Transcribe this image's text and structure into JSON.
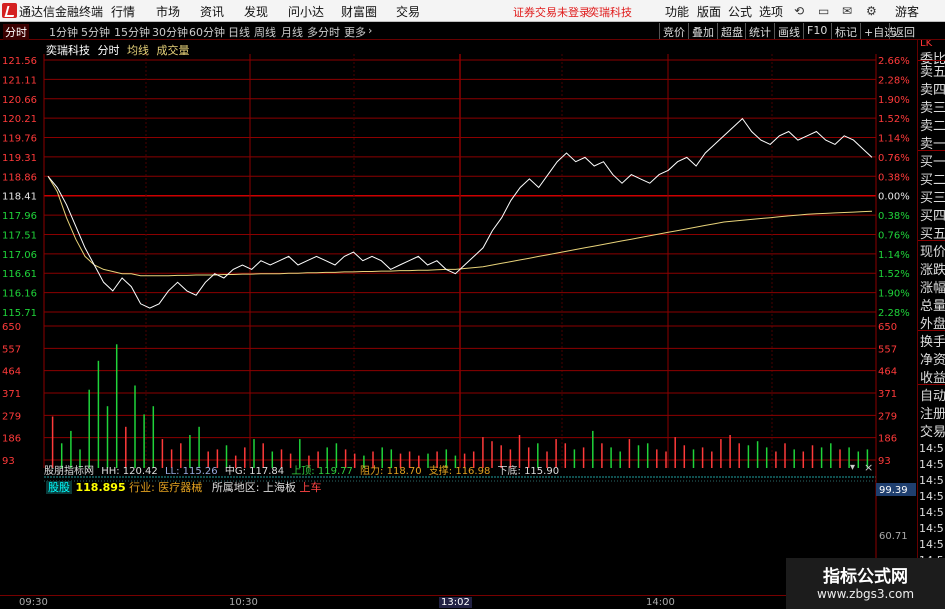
{
  "titlebar": {
    "app_title": "通达信金融终端",
    "menus": [
      "行情",
      "市场",
      "资讯",
      "发现",
      "问小达",
      "财富圈",
      "交易"
    ],
    "warning": "证券交易未登录",
    "stock_name": "奕瑞科技",
    "right_menus": [
      "功能",
      "版面",
      "公式",
      "选项"
    ],
    "guest": "游客"
  },
  "tabbar": {
    "tabs": [
      "分时",
      "1分钟",
      "5分钟",
      "15分钟",
      "30分钟",
      "60分钟",
      "日线",
      "周线",
      "月线",
      "多分时",
      "更多"
    ],
    "right_buttons": [
      "竞价",
      "叠加",
      "超盘",
      "统计",
      "画线",
      "F10",
      "标记",
      "+自选",
      "返回"
    ]
  },
  "chart_info": {
    "name": "奕瑞科技",
    "mode": "分时",
    "avg_label": "均线",
    "vol_label": "成交量"
  },
  "colors": {
    "price_line": "#ffffff",
    "avg_line": "#e8d37a",
    "grid": "#8b0000",
    "up": "#ff3a3a",
    "down": "#1fd43a",
    "neutral_axis": "#e6e6e6"
  },
  "chart_data": {
    "type": "line",
    "x_ticks": [
      "09:30",
      "10:30",
      "13:02",
      "14:00"
    ],
    "price_axis": [
      "121.56",
      "121.11",
      "120.66",
      "120.21",
      "119.76",
      "119.31",
      "118.86",
      "118.41",
      "117.96",
      "117.51",
      "117.06",
      "116.61",
      "116.16",
      "115.71"
    ],
    "pct_axis": [
      "2.66%",
      "2.28%",
      "1.90%",
      "1.52%",
      "1.14%",
      "0.76%",
      "0.38%",
      "0.00%",
      "0.38%",
      "0.76%",
      "1.14%",
      "1.52%",
      "1.90%",
      "2.28%"
    ],
    "prev_close": 118.41,
    "ylim": [
      115.71,
      121.56
    ],
    "volume_axis": [
      "650",
      "557",
      "464",
      "371",
      "279",
      "186",
      "93"
    ],
    "volume_max": 650,
    "series": [
      {
        "name": "价格",
        "values": [
          118.86,
          118.6,
          118.2,
          117.7,
          117.2,
          116.8,
          116.4,
          116.2,
          116.5,
          116.3,
          115.9,
          115.8,
          115.9,
          116.2,
          116.4,
          116.2,
          116.1,
          116.4,
          116.6,
          116.5,
          116.7,
          116.8,
          116.7,
          116.9,
          116.8,
          116.9,
          117.0,
          116.8,
          116.9,
          117.0,
          116.9,
          116.8,
          117.0,
          117.1,
          116.9,
          117.0,
          116.9,
          116.7,
          116.8,
          116.9,
          117.0,
          116.8,
          116.9,
          116.7,
          116.6,
          116.8,
          117.0,
          117.2,
          117.6,
          117.9,
          118.3,
          118.6,
          118.8,
          118.6,
          118.9,
          119.2,
          119.4,
          119.2,
          119.3,
          119.1,
          119.2,
          118.9,
          118.7,
          118.9,
          118.8,
          118.7,
          118.9,
          119.0,
          119.2,
          119.3,
          119.1,
          119.4,
          119.6,
          119.8,
          120.0,
          120.2,
          119.9,
          119.7,
          119.6,
          119.8,
          119.9,
          119.7,
          119.8,
          119.9,
          119.7,
          119.6,
          119.8,
          119.7,
          119.5,
          119.3
        ],
        "color": "#ffffff"
      },
      {
        "name": "均线",
        "values": [
          118.86,
          118.5,
          117.9,
          117.4,
          117.0,
          116.8,
          116.7,
          116.65,
          116.6,
          116.6,
          116.55,
          116.55,
          116.55,
          116.55,
          116.56,
          116.56,
          116.57,
          116.57,
          116.57,
          116.58,
          116.58,
          116.59,
          116.59,
          116.6,
          116.6,
          116.6,
          116.61,
          116.61,
          116.62,
          116.62,
          116.63,
          116.63,
          116.64,
          116.64,
          116.65,
          116.65,
          116.66,
          116.66,
          116.67,
          116.67,
          116.68,
          116.68,
          116.69,
          116.7,
          116.7,
          116.72,
          116.74,
          116.76,
          116.8,
          116.84,
          116.88,
          116.92,
          116.96,
          117.0,
          117.04,
          117.08,
          117.12,
          117.16,
          117.2,
          117.24,
          117.28,
          117.32,
          117.36,
          117.4,
          117.44,
          117.48,
          117.52,
          117.56,
          117.6,
          117.64,
          117.68,
          117.72,
          117.76,
          117.8,
          117.82,
          117.84,
          117.86,
          117.88,
          117.9,
          117.92,
          117.94,
          117.96,
          117.98,
          117.99,
          118.0,
          118.01,
          118.02,
          118.03,
          118.04,
          118.05
        ],
        "color": "#e8d37a"
      }
    ],
    "volumes": [
      250,
      120,
      180,
      90,
      380,
      520,
      300,
      600,
      200,
      400,
      260,
      300,
      140,
      90,
      120,
      160,
      200,
      80,
      90,
      110,
      60,
      100,
      140,
      120,
      80,
      90,
      70,
      140,
      60,
      80,
      100,
      120,
      90,
      70,
      60,
      80,
      100,
      90,
      70,
      80,
      60,
      70,
      80,
      90,
      60,
      70,
      80,
      150,
      130,
      110,
      90,
      160,
      100,
      120,
      80,
      140,
      120,
      90,
      100,
      180,
      120,
      100,
      80,
      140,
      110,
      120,
      90,
      80,
      150,
      110,
      90,
      100,
      80,
      140,
      160,
      120,
      110,
      130,
      100,
      80,
      120,
      90,
      80,
      110,
      100,
      120,
      90,
      100,
      80,
      90
    ],
    "grid": true
  },
  "indicator_bar": {
    "label": "股朋指标网",
    "hh": "HH: 120.42",
    "ll": "LL: 115.26",
    "mid": "中G: 117.84",
    "up_bound": "上顶: 119.77",
    "resist": "阻力: 118.70",
    "support": "支撑: 116.98",
    "down_bound": "下底: 115.90",
    "level_top": "99.39",
    "level_mid": "60.71"
  },
  "info_line": {
    "tag": "股股",
    "value": "118.895",
    "industry": "行业: 医疗器械",
    "region": "所属地区: 上海板",
    "tail": "上车"
  },
  "right_panel": {
    "top_label": "LK",
    "items": [
      "委比",
      "卖五",
      "卖四",
      "卖三",
      "卖二",
      "卖一",
      "买一",
      "买二",
      "买三",
      "买四",
      "买五",
      "现价",
      "涨跌",
      "涨幅",
      "总量",
      "外盘",
      "换手",
      "净资",
      "收益",
      "自动",
      "注册",
      "交易"
    ],
    "times": [
      "14:5",
      "14:5",
      "14:5",
      "14:5",
      "14:5",
      "14:5",
      "14:5",
      "14:5"
    ]
  },
  "time_axis": {
    "labels": [
      "09:30",
      "10:30",
      "13:02",
      "14:00"
    ]
  },
  "watermark": {
    "line1": "指标公式网",
    "line2": "www.zbgs3.com"
  }
}
